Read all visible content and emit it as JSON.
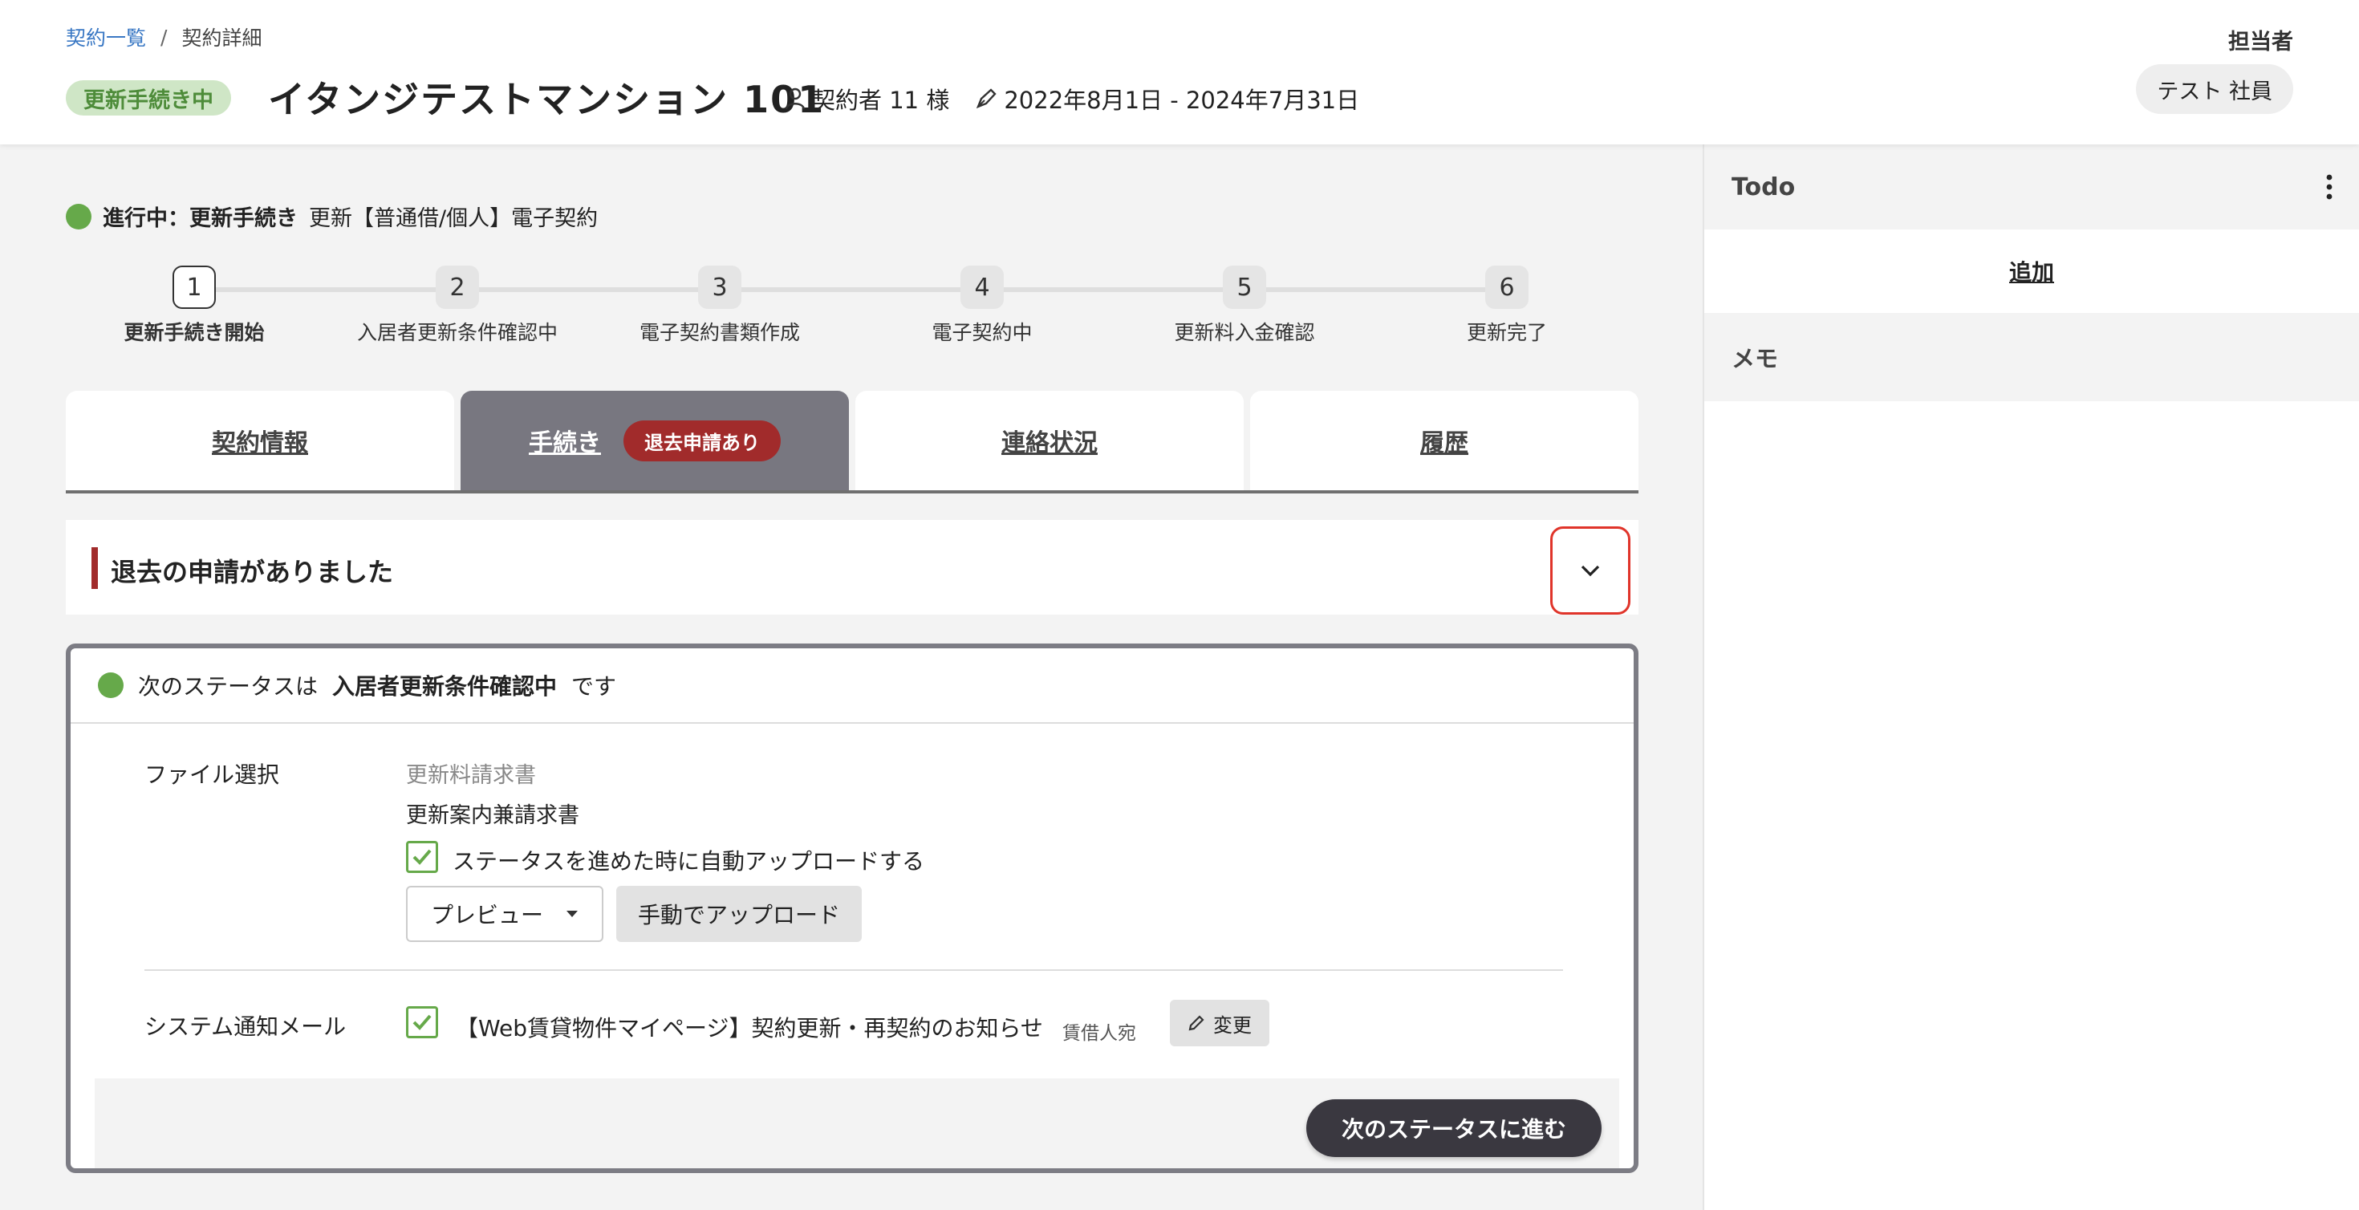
{
  "breadcrumb": {
    "parent": "契約一覧",
    "separator": "/",
    "current": "契約詳細"
  },
  "header": {
    "status_badge": "更新手続き中",
    "title": "イタンジテストマンション 101",
    "contractor": "契約者 11 様",
    "period": "2022年8月1日 - 2024年7月31日",
    "assignee_label": "担当者",
    "assignee_name": "テスト 社員"
  },
  "progress": {
    "status_prefix": "進行中：更新手続き",
    "status_detail": "更新【普通借/個人】電子契約",
    "steps": [
      {
        "num": "1",
        "label": "更新手続き開始"
      },
      {
        "num": "2",
        "label": "入居者更新条件確認中"
      },
      {
        "num": "3",
        "label": "電子契約書類作成"
      },
      {
        "num": "4",
        "label": "電子契約中"
      },
      {
        "num": "5",
        "label": "更新料入金確認"
      },
      {
        "num": "6",
        "label": "更新完了"
      }
    ]
  },
  "tabs": [
    {
      "label": "契約情報"
    },
    {
      "label": "手続き",
      "badge": "退去申請あり"
    },
    {
      "label": "連絡状況"
    },
    {
      "label": "履歴"
    }
  ],
  "alert": {
    "text": "退去の申請がありました"
  },
  "card": {
    "next_prefix": "次のステータスは",
    "next_status": "入居者更新条件確認中",
    "next_suffix": "です",
    "file_label": "ファイル選択",
    "file_option_1": "更新料請求書",
    "file_option_2": "更新案内兼請求書",
    "auto_upload_label": "ステータスを進めた時に自動アップロードする",
    "preview_button": "プレビュー",
    "manual_upload_button": "手動でアップロード",
    "mail_label": "システム通知メール",
    "mail_title": "【Web賃貸物件マイページ】契約更新・再契約のお知らせ",
    "mail_recipient": "賃借人宛",
    "edit_button": "変更",
    "next_button": "次のステータスに進む"
  },
  "panel": {
    "todo_title": "Todo",
    "todo_add": "追加",
    "memo_title": "メモ"
  },
  "colors": {
    "accent_green": "#66a94a",
    "alert_red": "#a12b2b",
    "active_tab": "#787780"
  }
}
